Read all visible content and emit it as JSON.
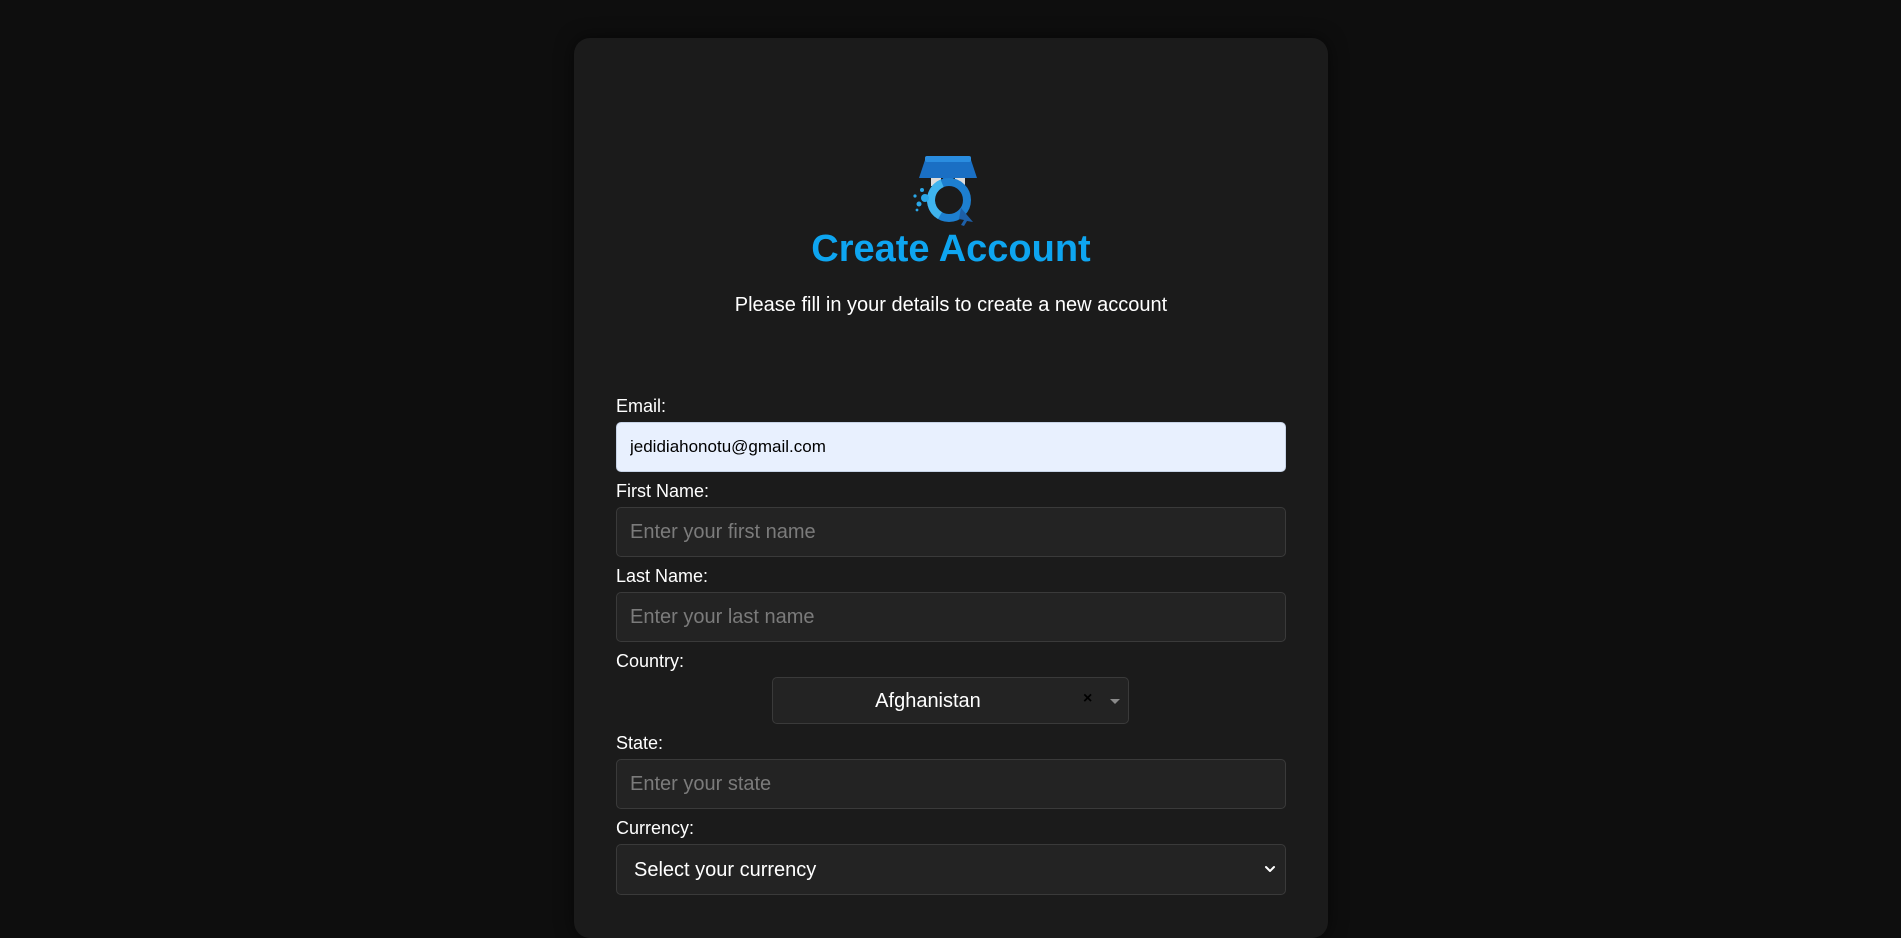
{
  "header": {
    "logo_icon": "storefront-cursor-logo",
    "title": "Create Account",
    "subtitle": "Please fill in your details to create a new account"
  },
  "form": {
    "email": {
      "label": "Email:",
      "value": "jedidiahonotu@gmail.com"
    },
    "first_name": {
      "label": "First Name:",
      "placeholder": "Enter your first name"
    },
    "last_name": {
      "label": "Last Name:",
      "placeholder": "Enter your last name"
    },
    "country": {
      "label": "Country:",
      "value": "Afghanistan",
      "clear_icon": "×"
    },
    "state": {
      "label": "State:",
      "placeholder": "Enter your state"
    },
    "currency": {
      "label": "Currency:",
      "value": "Select your currency"
    }
  },
  "colors": {
    "accent": "#0ea5f0",
    "background": "#0e0e0e",
    "card": "#1b1b1b",
    "input": "#232323"
  }
}
